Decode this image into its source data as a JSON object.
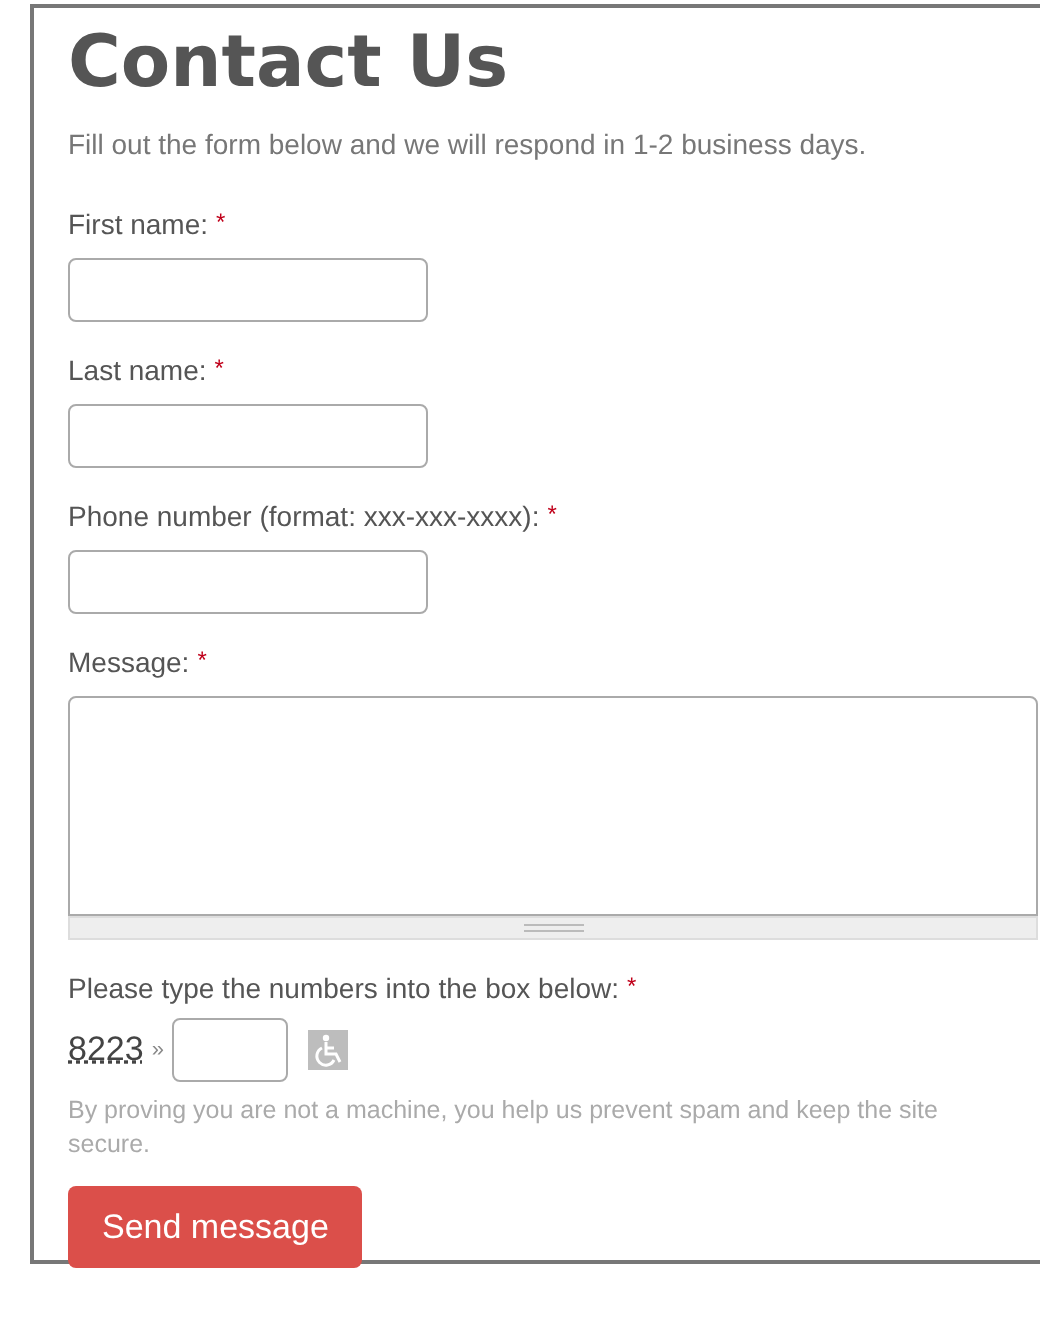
{
  "title": "Contact Us",
  "intro": "Fill out the form below and we will respond in 1-2 business days.",
  "fields": [
    {
      "kind": "input",
      "label": "First name:",
      "required_mark": "*"
    },
    {
      "kind": "input",
      "label": "Last name:",
      "required_mark": "*"
    },
    {
      "kind": "input",
      "label": "Phone number (format: xxx-xxx-xxxx):",
      "required_mark": "*"
    },
    {
      "kind": "textarea",
      "label": "Message:",
      "required_mark": "*"
    },
    {
      "kind": "captcha",
      "label": "Please type the numbers into the box below:",
      "required_mark": "*",
      "code": "8223",
      "separator": "»",
      "hint": "By proving you are not a machine, you help us prevent spam and keep the site secure."
    }
  ],
  "submit": "Send message"
}
